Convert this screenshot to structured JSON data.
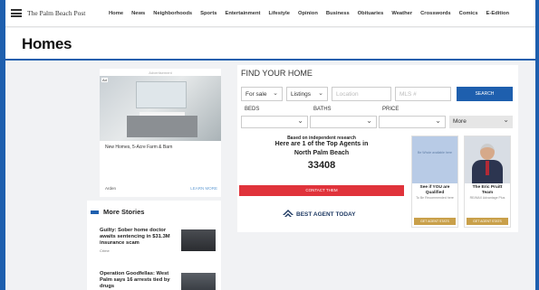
{
  "topnav": {
    "brand": "The Palm Beach Post",
    "links": [
      "Home",
      "News",
      "Neighborhoods",
      "Sports",
      "Entertainment",
      "Lifestyle",
      "Opinion",
      "Business",
      "Obituaries",
      "Weather",
      "Crosswords",
      "Comics",
      "E-Edition"
    ]
  },
  "section": {
    "title": "Homes"
  },
  "ad": {
    "label": "Advertisement",
    "badge": "Ad",
    "headline": "New Homes, 5-Acre Farm & Barn",
    "advertiser": "Arden",
    "cta": "LEARN MORE"
  },
  "finder": {
    "title": "FIND YOUR HOME",
    "sale_value": "For sale",
    "listings_value": "Listings",
    "location_placeholder": "Location",
    "mls_placeholder": "MLS #",
    "search_label": "SEARCH",
    "beds_label": "BEDS",
    "baths_label": "BATHS",
    "price_label": "PRICE",
    "more_label": "More"
  },
  "agent_promo": {
    "line1": "Based on independent research",
    "line2": "Here are 1 of the Top Agents in",
    "line3": "North Palm Beach",
    "zip": "33408",
    "cta": "CONTACT THEM",
    "logo_text": "BEST AGENT TODAY",
    "tiles": [
      {
        "image_text": "Be Whole available here",
        "title": "See if YOU are Qualified",
        "subtitle": "To Be Recommended here",
        "button": "GET AGENT STATS"
      },
      {
        "title": "The Eric Pruitt Team",
        "subtitle": "RE/MAX Advantage Plus",
        "button": "GET AGENT STATS"
      }
    ]
  },
  "stories": {
    "title": "More Stories",
    "items": [
      {
        "headline": "Guilty: Sober home doctor awaits sentencing in $31.3M insurance scam",
        "category": "Crime"
      },
      {
        "headline": "Operation Goodfellas: West Palm says 16 arrests tied by drugs",
        "category": ""
      }
    ]
  },
  "colors": {
    "accent": "#1e5fae",
    "cta_red": "#e0333b",
    "tile_button": "#c9a04a"
  }
}
